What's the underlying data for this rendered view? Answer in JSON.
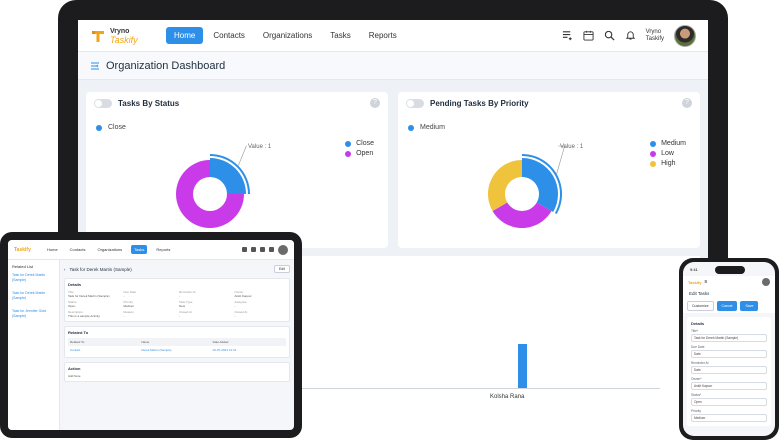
{
  "nav": {
    "brand_top": "Vryno",
    "brand_bottom": "Taskify",
    "links": [
      "Home",
      "Contacts",
      "Organizations",
      "Tasks",
      "Reports"
    ],
    "active": "Home",
    "user_line1": "Vryno",
    "user_line2": "Taskify"
  },
  "page_title": "Organization Dashboard",
  "cards": [
    {
      "title": "Tasks By Status",
      "selected": "Close",
      "tooltip": "Value : 1",
      "legend": [
        {
          "label": "Close",
          "color": "#2e8fe8"
        },
        {
          "label": "Open",
          "color": "#c93be8"
        }
      ]
    },
    {
      "title": "Pending Tasks By Priority",
      "selected": "Medium",
      "tooltip": "Value : 1",
      "legend": [
        {
          "label": "Medium",
          "color": "#2e8fe8"
        },
        {
          "label": "Low",
          "color": "#c93be8"
        },
        {
          "label": "High",
          "color": "#f0c33c"
        }
      ]
    }
  ],
  "chart_data": [
    {
      "type": "pie",
      "categories": [
        "Close",
        "Open"
      ],
      "values": [
        1,
        3
      ]
    },
    {
      "type": "pie",
      "categories": [
        "Medium",
        "Low",
        "High"
      ],
      "values": [
        1,
        1,
        1
      ]
    },
    {
      "type": "bar",
      "categories": [
        "Kolsha Rana"
      ],
      "values": [
        1
      ]
    }
  ],
  "tablet": {
    "brand": "Taskify",
    "links": [
      "Home",
      "Contacts",
      "Organizations",
      "Tasks",
      "Reports"
    ],
    "active": "Tasks",
    "side_title": "Related List",
    "side_items": [
      "Task for Derek Martin (Sample)",
      "Task for Derek Martin (Sample)",
      "Task for Jennifer Gold (Sample)"
    ],
    "record_title": "Task for Derek Martin (Sample)",
    "edit_btn": "Edit",
    "details_title": "Details",
    "fields": [
      {
        "label": "Title",
        "value": "Task for Derek Martin (Sample)"
      },
      {
        "label": "Due Date",
        "value": "-"
      },
      {
        "label": "Reminder At",
        "value": "-"
      },
      {
        "label": "Owner",
        "value": "Ankit Kapoor"
      },
      {
        "label": "Status",
        "value": "Open"
      },
      {
        "label": "Priority",
        "value": "Medium"
      },
      {
        "label": "Task Type",
        "value": "New"
      },
      {
        "label": "Assignee",
        "value": "-"
      },
      {
        "label": "Description",
        "value": "This is a sample Activity"
      },
      {
        "label": "Reason",
        "value": "-"
      },
      {
        "label": "Closed At",
        "value": "-"
      },
      {
        "label": "Closed At",
        "value": "-"
      }
    ],
    "related_title": "Related To",
    "related_cols": [
      "Related To",
      "Name",
      "Date Added"
    ],
    "related_row": [
      "Contact",
      "Derek Martin (Sample)",
      "02-07-2024 12:31"
    ],
    "action_title": "Action",
    "note_title": "Add Note"
  },
  "phone": {
    "time": "9:41",
    "brand": "Taskify",
    "page_title": "Edit Tasks",
    "actions": [
      "Customize",
      "Cancel",
      "Save"
    ],
    "section": "Details",
    "fields": [
      {
        "label": "Title*",
        "value": "Task for Derek Martin (Sample)"
      },
      {
        "label": "Due Date",
        "value": "Date"
      },
      {
        "label": "Reminder At",
        "value": "Date"
      },
      {
        "label": "Owner*",
        "value": "Ankit Kapoor"
      },
      {
        "label": "Status*",
        "value": "Open"
      },
      {
        "label": "Priority",
        "value": "Medium"
      }
    ]
  }
}
